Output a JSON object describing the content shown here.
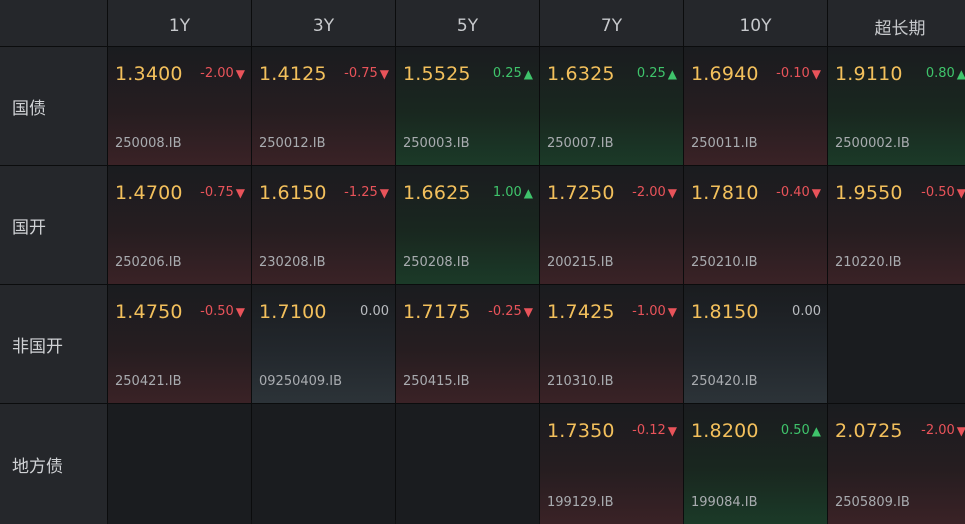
{
  "columns": [
    "1Y",
    "3Y",
    "5Y",
    "7Y",
    "10Y",
    "超长期"
  ],
  "rows": [
    {
      "label": "国债",
      "cells": [
        {
          "yield": "1.3400",
          "change": "-2.00",
          "dir": "down",
          "code": "250008.IB"
        },
        {
          "yield": "1.4125",
          "change": "-0.75",
          "dir": "down",
          "code": "250012.IB"
        },
        {
          "yield": "1.5525",
          "change": "0.25",
          "dir": "up",
          "code": "250003.IB"
        },
        {
          "yield": "1.6325",
          "change": "0.25",
          "dir": "up",
          "code": "250007.IB"
        },
        {
          "yield": "1.6940",
          "change": "-0.10",
          "dir": "down",
          "code": "250011.IB"
        },
        {
          "yield": "1.9110",
          "change": "0.80",
          "dir": "up",
          "code": "2500002.IB"
        }
      ]
    },
    {
      "label": "国开",
      "cells": [
        {
          "yield": "1.4700",
          "change": "-0.75",
          "dir": "down",
          "code": "250206.IB"
        },
        {
          "yield": "1.6150",
          "change": "-1.25",
          "dir": "down",
          "code": "230208.IB"
        },
        {
          "yield": "1.6625",
          "change": "1.00",
          "dir": "up",
          "code": "250208.IB"
        },
        {
          "yield": "1.7250",
          "change": "-2.00",
          "dir": "down",
          "code": "200215.IB"
        },
        {
          "yield": "1.7810",
          "change": "-0.40",
          "dir": "down",
          "code": "250210.IB"
        },
        {
          "yield": "1.9550",
          "change": "-0.50",
          "dir": "down",
          "code": "210220.IB"
        }
      ]
    },
    {
      "label": "非国开",
      "cells": [
        {
          "yield": "1.4750",
          "change": "-0.50",
          "dir": "down",
          "code": "250421.IB"
        },
        {
          "yield": "1.7100",
          "change": "0.00",
          "dir": "zero",
          "code": "09250409.IB"
        },
        {
          "yield": "1.7175",
          "change": "-0.25",
          "dir": "down",
          "code": "250415.IB"
        },
        {
          "yield": "1.7425",
          "change": "-1.00",
          "dir": "down",
          "code": "210310.IB"
        },
        {
          "yield": "1.8150",
          "change": "0.00",
          "dir": "zero",
          "code": "250420.IB"
        },
        null
      ]
    },
    {
      "label": "地方债",
      "cells": [
        null,
        null,
        null,
        {
          "yield": "1.7350",
          "change": "-0.12",
          "dir": "down",
          "code": "199129.IB"
        },
        {
          "yield": "1.8200",
          "change": "0.50",
          "dir": "up",
          "code": "199084.IB"
        },
        {
          "yield": "2.0725",
          "change": "-2.00",
          "dir": "down",
          "code": "2505809.IB"
        }
      ]
    }
  ],
  "icons": {
    "up": "triangle-up-icon",
    "down": "triangle-down-icon"
  },
  "colors": {
    "yield": "#f3c05c",
    "down": "#e9535a",
    "up": "#3fc46b",
    "zero": "#b9bcc0"
  }
}
